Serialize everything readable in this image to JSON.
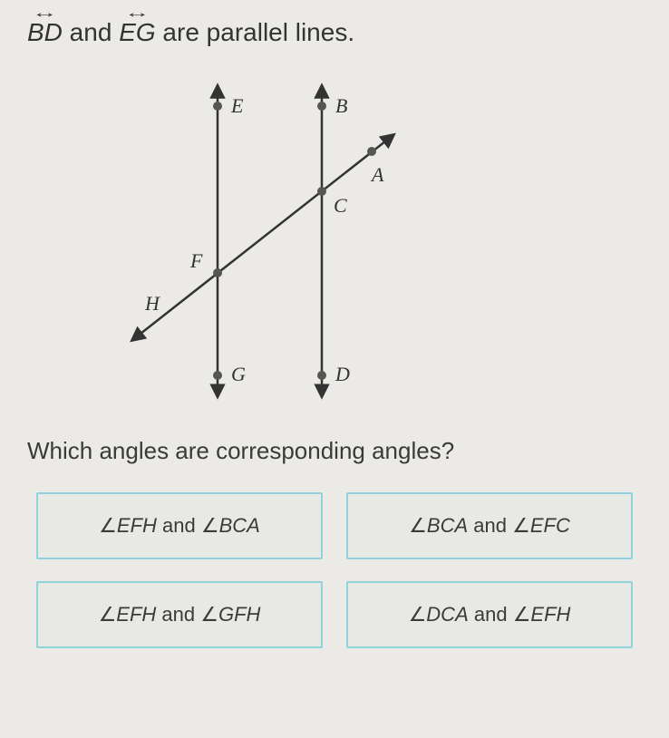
{
  "statement": {
    "line1_label": "BD",
    "connector": " and ",
    "line2_label": "EG",
    "rest": " are parallel lines."
  },
  "diagram": {
    "points": {
      "E": "E",
      "B": "B",
      "A": "A",
      "C": "C",
      "F": "F",
      "H": "H",
      "G": "G",
      "D": "D"
    }
  },
  "question": "Which angles are corresponding angles?",
  "answers": [
    {
      "a1": "EFH",
      "conn": " and ",
      "a2": "BCA"
    },
    {
      "a1": "BCA",
      "conn": " and ",
      "a2": "EFC"
    },
    {
      "a1": "EFH",
      "conn": " and ",
      "a2": "GFH"
    },
    {
      "a1": "DCA",
      "conn": " and ",
      "a2": "EFH"
    }
  ]
}
